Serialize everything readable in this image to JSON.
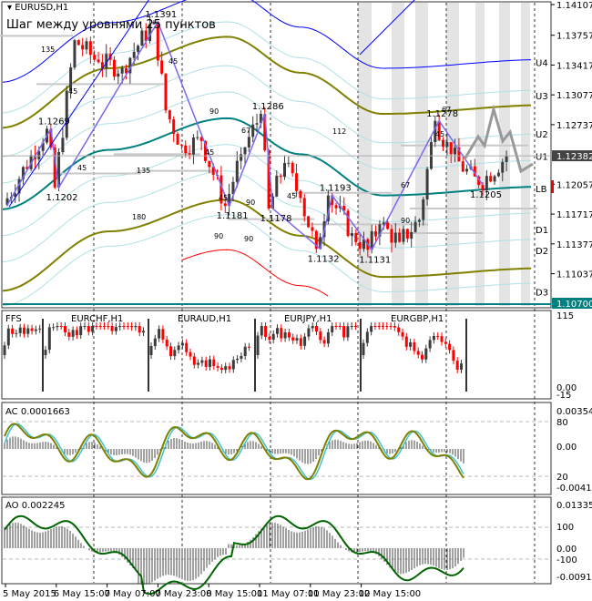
{
  "main": {
    "symbol": "EURUSD,H1",
    "note": "Шаг между уровнями 25 пунктов",
    "current_price": "1.12382",
    "bottom_price": "1.10700",
    "price_ticks": [
      "1.14107",
      "1.13757",
      "1.13417",
      "1.13077",
      "1.12737",
      "1.12057",
      "1.11717",
      "1.11377",
      "1.11037"
    ],
    "price_max": 1.14107,
    "price_min": 1.107,
    "levels": [
      {
        "label": "U4",
        "price": 1.1345
      },
      {
        "label": "U3",
        "price": 1.1307
      },
      {
        "label": "U2",
        "price": 1.1263
      },
      {
        "label": "U1",
        "price": 1.1238
      },
      {
        "label": "LB",
        "price": 1.1201
      },
      {
        "label": "D1",
        "price": 1.1154
      },
      {
        "label": "D2",
        "price": 1.113
      },
      {
        "label": "D3",
        "price": 1.1083
      }
    ],
    "zigzag_labels": [
      {
        "text": "1.1269",
        "bar": 11,
        "price": 1.1269,
        "pos": "top"
      },
      {
        "text": "1.1202",
        "bar": 13,
        "price": 1.1202,
        "pos": "bottom"
      },
      {
        "text": "1.1391",
        "bar": 38,
        "price": 1.1391,
        "pos": "top"
      },
      {
        "text": "1.1286",
        "bar": 65,
        "price": 1.1286,
        "pos": "top"
      },
      {
        "text": "1.1181",
        "bar": 56,
        "price": 1.1181,
        "pos": "bottom"
      },
      {
        "text": "1.1178",
        "bar": 67,
        "price": 1.1178,
        "pos": "bottom"
      },
      {
        "text": "1.1193",
        "bar": 82,
        "price": 1.1193,
        "pos": "top"
      },
      {
        "text": "1.1132",
        "bar": 79,
        "price": 1.1132,
        "pos": "bottom"
      },
      {
        "text": "1.1131",
        "bar": 92,
        "price": 1.1131,
        "pos": "bottom"
      },
      {
        "text": "1.1278",
        "bar": 109,
        "price": 1.1278,
        "pos": "top"
      },
      {
        "text": "1.1205",
        "bar": 120,
        "price": 1.1205,
        "pos": "bottom"
      }
    ],
    "angle_labels": [
      "135",
      "45",
      "45",
      "45",
      "90",
      "67",
      "135",
      "45",
      "90",
      "180",
      "45",
      "90",
      "67",
      "112",
      "45",
      "90",
      "67",
      "45",
      "90"
    ],
    "price_path": [
      [
        0,
        1.1182
      ],
      [
        11,
        1.1269
      ],
      [
        13,
        1.1202
      ],
      [
        18,
        1.137
      ],
      [
        24,
        1.1345
      ],
      [
        30,
        1.1338
      ],
      [
        38,
        1.1391
      ],
      [
        41,
        1.129
      ],
      [
        45,
        1.125
      ],
      [
        50,
        1.1255
      ],
      [
        56,
        1.1181
      ],
      [
        60,
        1.124
      ],
      [
        65,
        1.1286
      ],
      [
        67,
        1.1178
      ],
      [
        71,
        1.123
      ],
      [
        75,
        1.119
      ],
      [
        79,
        1.1132
      ],
      [
        82,
        1.1193
      ],
      [
        88,
        1.115
      ],
      [
        92,
        1.1131
      ],
      [
        95,
        1.116
      ],
      [
        100,
        1.114
      ],
      [
        105,
        1.1165
      ],
      [
        109,
        1.1278
      ],
      [
        113,
        1.124
      ],
      [
        120,
        1.1205
      ],
      [
        127,
        1.1238
      ]
    ]
  },
  "panes": {
    "ffs": {
      "title": "FFS",
      "max": "115",
      "zero": "0.00",
      "min": "-15",
      "symbols": [
        "EURCHF,H1",
        "EURAUD,H1",
        "EURJPY,H1",
        "EURGBP,H1"
      ]
    },
    "ac": {
      "title": "AC 0.0001663",
      "max": "0.003540",
      "upper": "80",
      "zero": "0.00",
      "lower": "20",
      "min": "-0.004110"
    },
    "ao": {
      "title": "AO 0.002245",
      "max": "0.013356",
      "upper": "100",
      "zero": "0.00",
      "lower": "-100",
      "min": "-0.009123"
    }
  },
  "time_axis": [
    "5 May 2015",
    "6 May 15:00",
    "7 May 07:00",
    "7 May 23:00",
    "8 May 15:00",
    "11 May 07:00",
    "11 May 23:00",
    "12 May 15:00"
  ],
  "colors": {
    "bull": "#3c3c3c",
    "bear": "#ff0000",
    "teal": "#008080",
    "olive": "#808000",
    "blue": "#0000ff",
    "zigzag": "#7b68ee",
    "cyan": "#87cefa",
    "green": "#006400"
  }
}
